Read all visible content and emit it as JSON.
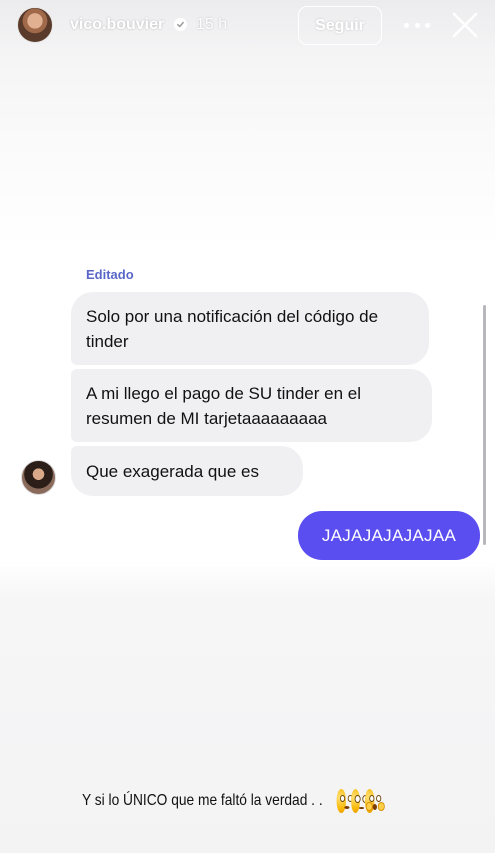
{
  "header": {
    "username": "vico.bouvier",
    "time_ago": "15 h",
    "follow_label": "Seguir"
  },
  "chat": {
    "edited_label": "Editado",
    "incoming": [
      "Solo por una notificación del código de tinder",
      "A mi llego el pago de SU tinder en el resumen de MI tarjetaaaaaaaaa",
      "Que exagerada que es"
    ],
    "outgoing": [
      "JAJAJAJAJAJAA"
    ]
  },
  "caption": {
    "text": "Y si lo ÚNICO que me faltó  la verdad . . "
  },
  "icons": {
    "verified": "verified-badge-icon",
    "more": "more-icon",
    "close": "close-icon",
    "emojis": [
      "pleading-face-icon",
      "flushed-face-icon",
      "shocked-face-icon"
    ]
  },
  "colors": {
    "outgoing_bubble": "#5b4ef0",
    "incoming_bubble": "#f0f0f2",
    "edited_label": "#5a67c9"
  }
}
